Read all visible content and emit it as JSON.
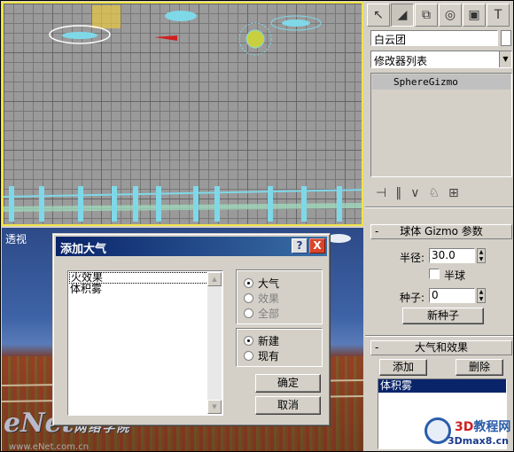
{
  "viewport_bottom": {
    "label": "透视"
  },
  "watermark": {
    "text": "eNet",
    "sub": "网络学院",
    "url": "www.eNet.com.cn"
  },
  "command_panel": {
    "tabs": [
      "create-icon",
      "modify-icon",
      "hierarchy-icon",
      "motion-icon",
      "display-icon",
      "utilities-icon"
    ],
    "object_name": "白云团",
    "modifier_list": "修改器列表",
    "stack_items": [
      "SphereGizmo"
    ],
    "gizmo_rollout": {
      "title": "球体 Gizmo 参数",
      "radius_label": "半径:",
      "radius_value": "30.0",
      "hemisphere_label": "半球",
      "hemisphere_checked": false,
      "seed_label": "种子:",
      "seed_value": "0",
      "new_seed_button": "新种子"
    },
    "atmos_rollout": {
      "title": "大气和效果",
      "add_button": "添加",
      "delete_button": "删除",
      "effects": [
        "体积雾"
      ]
    }
  },
  "dialog": {
    "title": "添加大气",
    "help_button": "?",
    "close_button": "X",
    "list_items": [
      "火效果",
      "体积雾"
    ],
    "scope_options": [
      {
        "label": "大气",
        "selected": true,
        "enabled": true
      },
      {
        "label": "效果",
        "selected": false,
        "enabled": false
      },
      {
        "label": "全部",
        "selected": false,
        "enabled": false
      }
    ],
    "mode_options": [
      {
        "label": "新建",
        "selected": true
      },
      {
        "label": "现有",
        "selected": false
      }
    ],
    "ok_button": "确定",
    "cancel_button": "取消"
  },
  "site_logo": {
    "text_a": "3D",
    "text_b": "教程网",
    "url": "3Dmax8.cn"
  }
}
